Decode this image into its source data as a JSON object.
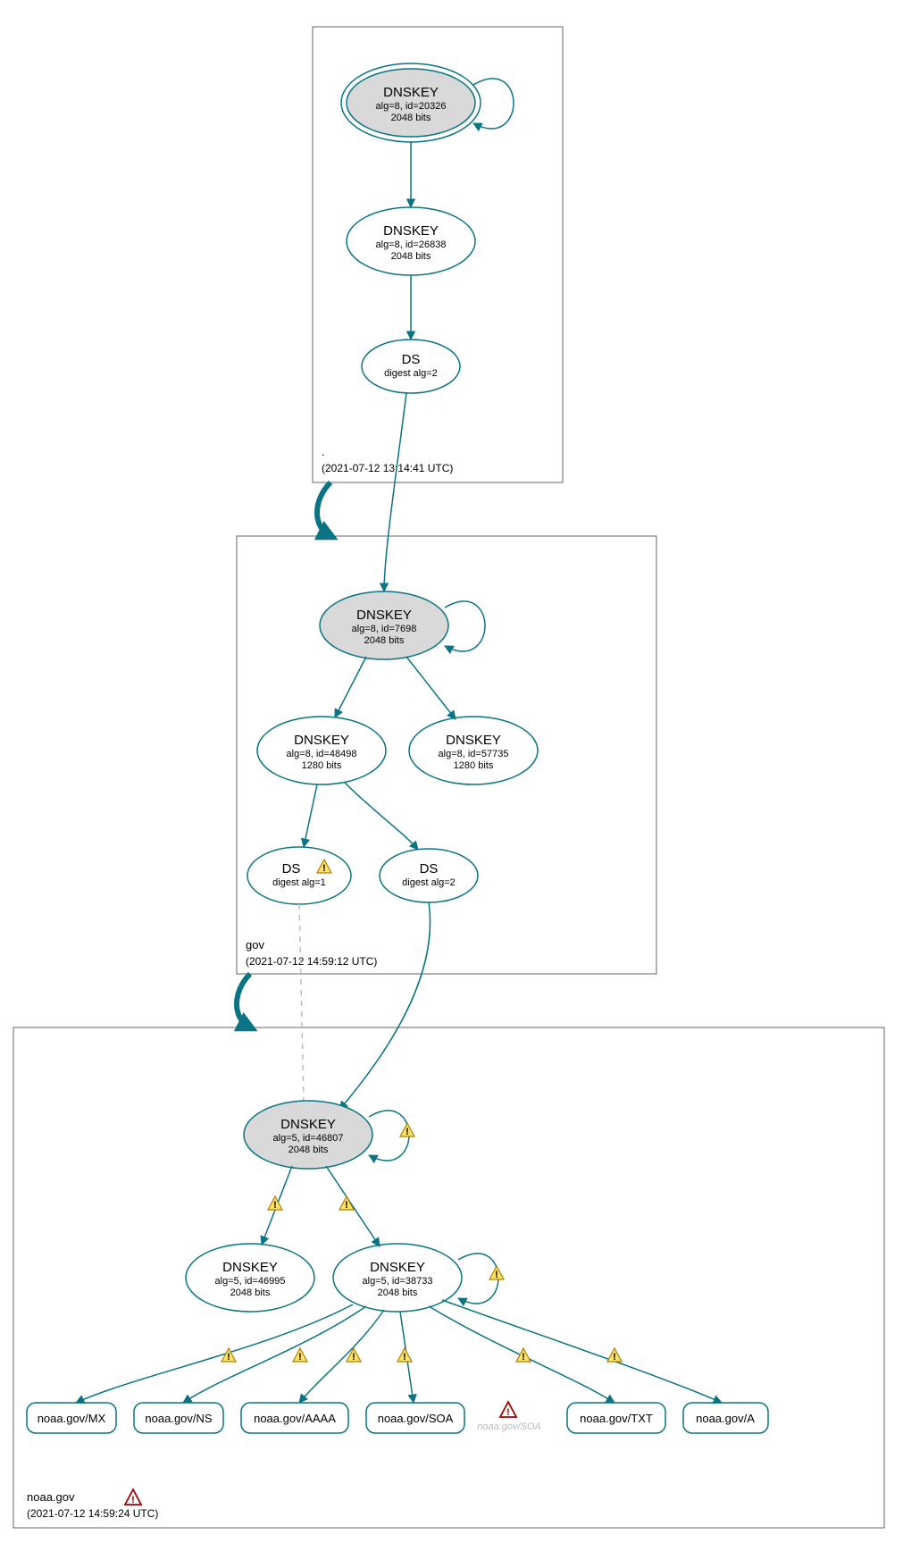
{
  "colors": {
    "stroke": "#0b7484",
    "fill_grey": "#d9d9d9"
  },
  "zones": {
    "root": {
      "label": ".",
      "timestamp": "(2021-07-12 13:14:41 UTC)"
    },
    "gov": {
      "label": "gov",
      "timestamp": "(2021-07-12 14:59:12 UTC)"
    },
    "noaa": {
      "label": "noaa.gov",
      "timestamp": "(2021-07-12 14:59:24 UTC)"
    }
  },
  "nodes": {
    "root_ksk": {
      "title": "DNSKEY",
      "sub1": "alg=8, id=20326",
      "sub2": "2048 bits"
    },
    "root_zsk": {
      "title": "DNSKEY",
      "sub1": "alg=8, id=26838",
      "sub2": "2048 bits"
    },
    "root_ds": {
      "title": "DS",
      "sub1": "digest alg=2",
      "sub2": ""
    },
    "gov_ksk": {
      "title": "DNSKEY",
      "sub1": "alg=8, id=7698",
      "sub2": "2048 bits"
    },
    "gov_zsk1": {
      "title": "DNSKEY",
      "sub1": "alg=8, id=48498",
      "sub2": "1280 bits"
    },
    "gov_zsk2": {
      "title": "DNSKEY",
      "sub1": "alg=8, id=57735",
      "sub2": "1280 bits"
    },
    "gov_ds1": {
      "title": "DS",
      "sub1": "digest alg=1",
      "sub2": ""
    },
    "gov_ds2": {
      "title": "DS",
      "sub1": "digest alg=2",
      "sub2": ""
    },
    "noaa_ksk": {
      "title": "DNSKEY",
      "sub1": "alg=5, id=46807",
      "sub2": "2048 bits"
    },
    "noaa_zsk1": {
      "title": "DNSKEY",
      "sub1": "alg=5, id=46995",
      "sub2": "2048 bits"
    },
    "noaa_zsk2": {
      "title": "DNSKEY",
      "sub1": "alg=5, id=38733",
      "sub2": "2048 bits"
    }
  },
  "rrsets": {
    "mx": "noaa.gov/MX",
    "ns": "noaa.gov/NS",
    "aaaa": "noaa.gov/AAAA",
    "soa": "noaa.gov/SOA",
    "txt": "noaa.gov/TXT",
    "a": "noaa.gov/A"
  },
  "ghost_soa": "noaa.gov/SOA"
}
